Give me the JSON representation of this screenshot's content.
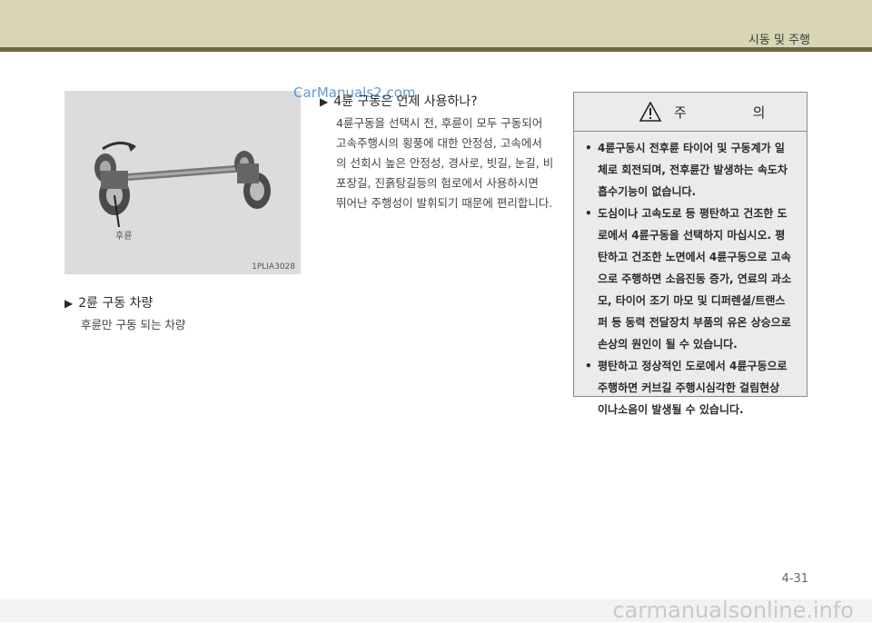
{
  "header": {
    "section_title": "시동 및 주행"
  },
  "figure": {
    "code": "1PLIA3028",
    "rear_label": "후륜"
  },
  "watermark_top": "CarManuals2.com",
  "left": {
    "heading": "2륜 구동 차량",
    "text": "후륜만 구동 되는 차량"
  },
  "middle": {
    "heading": "4륜 구동은 언제 사용하나?",
    "text_lines": [
      "4륜구동을 선택시 전, 후륜이 모두 구동되어",
      "고속주행시의 횡풍에 대한 안정성, 고속에서",
      "의 선회시 높은 안정성, 경사로, 빗길, 눈길, 비",
      "포장길, 진흙탕길등의 험로에서 사용하시면",
      "뛰어난 주행성이 발휘되기 때문에 편리합니다."
    ]
  },
  "caution": {
    "title": "주 의",
    "items": [
      [
        "4륜구동시 전후륜 타이어 및 구동계가 일",
        "체로 회전되며, 전후륜간 발생하는 속도차",
        "흡수기능이 없습니다."
      ],
      [
        "도심이나 고속도로 등 평탄하고 건조한 도",
        "로에서 4륜구동을 선택하지 마십시오. 평",
        "탄하고 건조한 노면에서 4륜구동으로 고속",
        "으로 주행하면 소음진동 증가, 연료의 과소",
        "모, 타이어 조기 마모 및 디퍼렌셜/트랜스",
        "퍼 등 동력 전달장치 부품의 유온 상승으로",
        "손상의 원인이 될 수 있습니다."
      ],
      [
        "평탄하고 정상적인 도로에서 4륜구동으로",
        "주행하면 커브길 주행시심각한 걸림현상",
        "이나소음이 발생될 수 있습니다."
      ]
    ]
  },
  "page_number": "4-31",
  "footer_watermark": "carmanualsonline.info"
}
